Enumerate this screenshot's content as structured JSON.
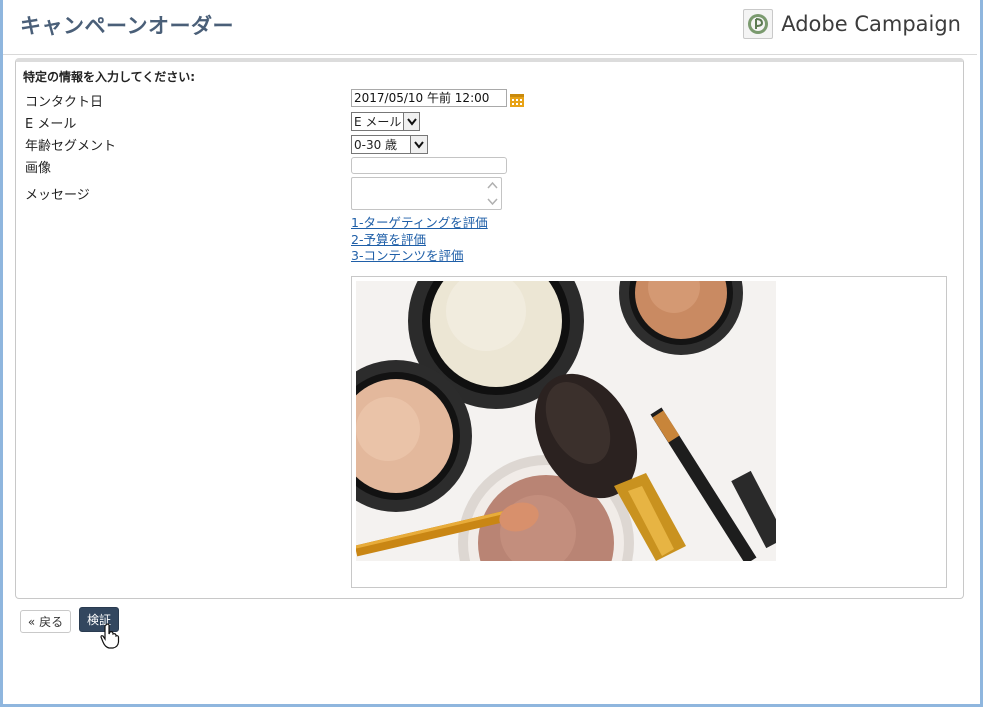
{
  "header": {
    "title": "キャンペーンオーダー",
    "brand_name": "Adobe Campaign"
  },
  "form": {
    "instruction": "特定の情報を入力してください:",
    "contact_date": {
      "label": "コンタクト日",
      "value": "2017/05/10 午前 12:00"
    },
    "email": {
      "label": "E メール",
      "selected": "E メール"
    },
    "age_segment": {
      "label": "年齢セグメント",
      "selected": "0-30 歳"
    },
    "image": {
      "label": "画像",
      "value": ""
    },
    "message": {
      "label": "メッセージ",
      "value": ""
    },
    "links": [
      {
        "label": "1-ターゲティングを評価"
      },
      {
        "label": "2-予算を評価"
      },
      {
        "label": "3-コンテンツを評価"
      }
    ]
  },
  "footer": {
    "back_label": "« 戻る",
    "verify_label": "検証"
  },
  "colors": {
    "title": "#4a5f78",
    "link": "#1f5fa8",
    "verify_button": "#33475f",
    "frame_border": "#8fb6de",
    "calendar_icon": "#e8a317"
  },
  "icons": [
    "adobe-campaign-logo-icon",
    "calendar-icon",
    "chevron-down-icon",
    "scroll-arrows-icon",
    "hand-pointer-icon"
  ]
}
